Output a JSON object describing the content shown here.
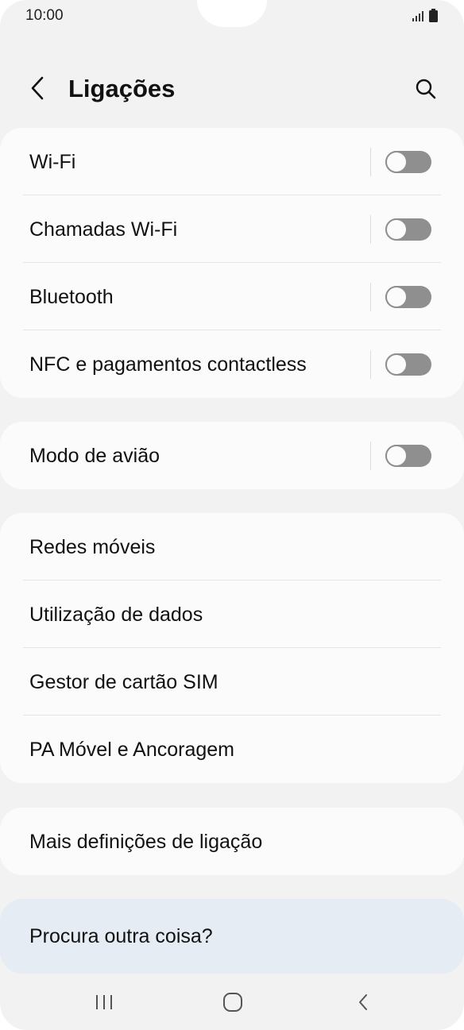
{
  "status_bar": {
    "time": "10:00"
  },
  "header": {
    "title": "Ligações"
  },
  "connections": [
    {
      "label": "Wi-Fi",
      "toggle_on": false
    },
    {
      "label": "Chamadas Wi-Fi",
      "toggle_on": false
    },
    {
      "label": "Bluetooth",
      "toggle_on": false
    },
    {
      "label": "NFC e pagamentos contactless",
      "toggle_on": false
    }
  ],
  "airplane": {
    "label": "Modo de avião",
    "toggle_on": false
  },
  "network_items": [
    {
      "label": "Redes móveis"
    },
    {
      "label": "Utilização de dados"
    },
    {
      "label": "Gestor de cartão SIM"
    },
    {
      "label": "PA Móvel e Ancoragem"
    }
  ],
  "more_settings": {
    "label": "Mais definições de ligação"
  },
  "search_prompt": {
    "label": "Procura outra coisa?"
  },
  "nav_bar": {
    "buttons": [
      "recents-icon",
      "home-icon",
      "back-icon"
    ]
  },
  "colors": {
    "toggle_off": "#8f8f8f",
    "card_bg": "#fbfbfb",
    "screen_bg": "#f2f2f2",
    "search_card_bg": "#e6ecf3"
  }
}
